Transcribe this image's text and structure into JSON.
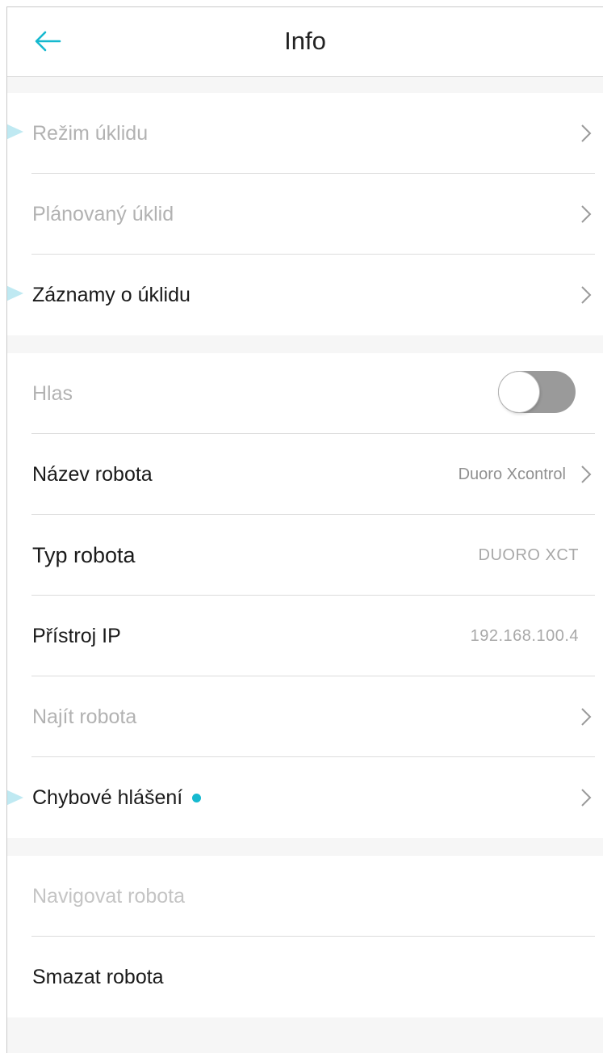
{
  "header": {
    "title": "Info"
  },
  "section1": {
    "items": [
      {
        "label": "Režim úklidu"
      },
      {
        "label": "Plánovaný úklid"
      },
      {
        "label": "Záznamy o úklidu"
      }
    ]
  },
  "section2": {
    "voice": {
      "label": "Hlas",
      "toggle_on": false
    },
    "robot_name": {
      "label": "Název robota",
      "value": "Duoro Xcontrol"
    },
    "robot_type": {
      "label": "Typ robota",
      "value": "DUORO XCT"
    },
    "device_ip": {
      "label": "Přístroj IP",
      "value": "192.168.100.4"
    },
    "find_robot": {
      "label": "Najít robota"
    },
    "error_report": {
      "label": "Chybové hlášení",
      "badge_color": "#16b9cf"
    }
  },
  "section3": {
    "navigate": {
      "label": "Navigovat robota"
    },
    "delete": {
      "label": "Smazat robota"
    }
  },
  "colors": {
    "accent": "#16b9cf",
    "dim_text": "#b2b2b2",
    "dark_text": "#1a1a1a"
  }
}
